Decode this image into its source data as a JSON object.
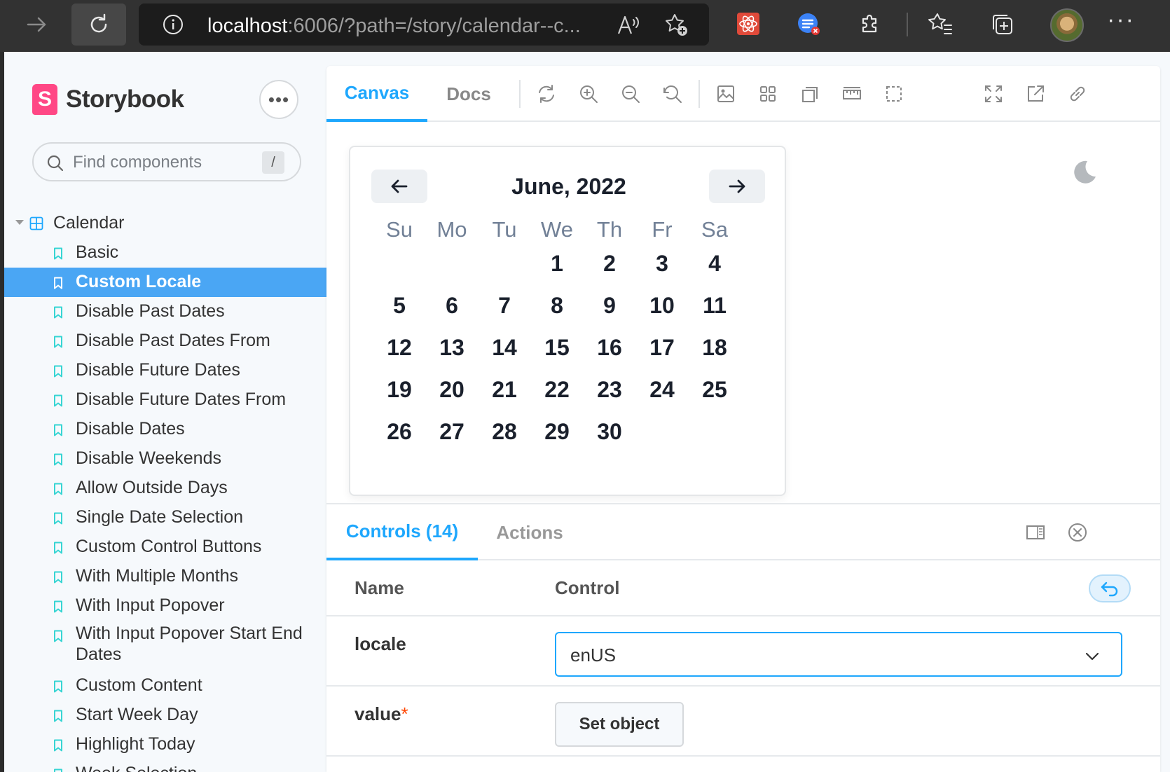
{
  "browser": {
    "url_host": "localhost",
    "url_rest": ":6006/?path=/story/calendar--c..."
  },
  "sidebar": {
    "brand": "Storybook",
    "brand_logo_letter": "S",
    "search_placeholder": "Find components",
    "search_shortcut": "/",
    "group": "Calendar",
    "items": [
      {
        "label": "Basic",
        "selected": false
      },
      {
        "label": "Custom Locale",
        "selected": true
      },
      {
        "label": "Disable Past Dates",
        "selected": false
      },
      {
        "label": "Disable Past Dates From",
        "selected": false
      },
      {
        "label": "Disable Future Dates",
        "selected": false
      },
      {
        "label": "Disable Future Dates From",
        "selected": false
      },
      {
        "label": "Disable Dates",
        "selected": false
      },
      {
        "label": "Disable Weekends",
        "selected": false
      },
      {
        "label": "Allow Outside Days",
        "selected": false
      },
      {
        "label": "Single Date Selection",
        "selected": false
      },
      {
        "label": "Custom Control Buttons",
        "selected": false
      },
      {
        "label": "With Multiple Months",
        "selected": false
      },
      {
        "label": "With Input Popover",
        "selected": false
      },
      {
        "label": "With Input Popover Start End Dates",
        "selected": false
      },
      {
        "label": "Custom Content",
        "selected": false
      },
      {
        "label": "Start Week Day",
        "selected": false
      },
      {
        "label": "Highlight Today",
        "selected": false
      },
      {
        "label": "Week Selection",
        "selected": false
      }
    ]
  },
  "toolbar": {
    "tab_canvas": "Canvas",
    "tab_docs": "Docs"
  },
  "calendar": {
    "title": "June, 2022",
    "weekdays": [
      "Su",
      "Mo",
      "Tu",
      "We",
      "Th",
      "Fr",
      "Sa"
    ],
    "first_weekday_index": 3,
    "days_in_month": 30
  },
  "addons": {
    "tab_controls": "Controls (14)",
    "tab_actions": "Actions",
    "col_name": "Name",
    "col_control": "Control",
    "rows": {
      "locale": {
        "name": "locale",
        "value": "enUS"
      },
      "value": {
        "name": "value",
        "required_mark": "*",
        "button": "Set object"
      }
    }
  },
  "colors": {
    "accent": "#1ea7fd",
    "selected_bg": "#4aa6f4",
    "storybook_pink": "#ff4785",
    "bookmark": "#37d5d3"
  }
}
